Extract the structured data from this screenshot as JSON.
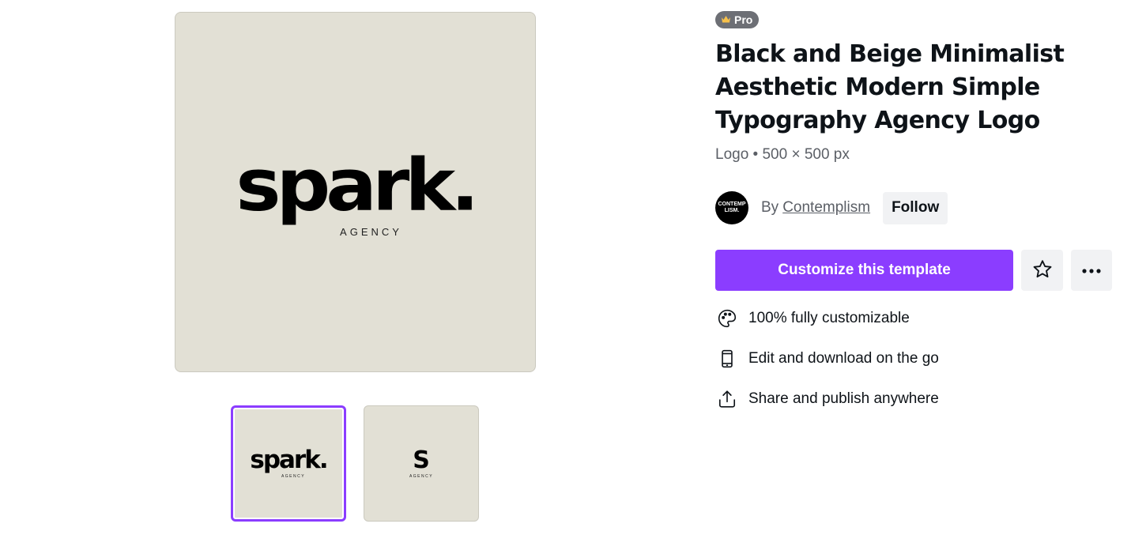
{
  "preview": {
    "logo_word": "spark.",
    "logo_sub": "AGENCY"
  },
  "thumbnails": [
    {
      "word": "spark.",
      "sub": "AGENCY",
      "selected": true
    },
    {
      "word": "S",
      "sub": "AGENCY",
      "selected": false
    }
  ],
  "badge": {
    "label": "Pro",
    "icon": "crown-icon"
  },
  "title": "Black and Beige Minimalist Aesthetic Modern Simple Typography Agency Logo",
  "meta": "Logo • 500 × 500 px",
  "author": {
    "avatar_line1": "CONTEMP",
    "avatar_line2": "LISM.",
    "by_label": "By",
    "name": "Contemplism",
    "follow_label": "Follow"
  },
  "actions": {
    "customize_label": "Customize this template",
    "star_icon": "star-icon",
    "more_icon": "more-icon"
  },
  "features": [
    {
      "icon": "palette-icon",
      "label": "100% fully customizable"
    },
    {
      "icon": "mobile-icon",
      "label": "Edit and download on the go"
    },
    {
      "icon": "share-icon",
      "label": "Share and publish anywhere"
    }
  ],
  "colors": {
    "accent": "#8b3dff",
    "preview_bg": "#e2e0d5",
    "badge_bg": "#6d6f75",
    "crown": "#f7c14b"
  }
}
